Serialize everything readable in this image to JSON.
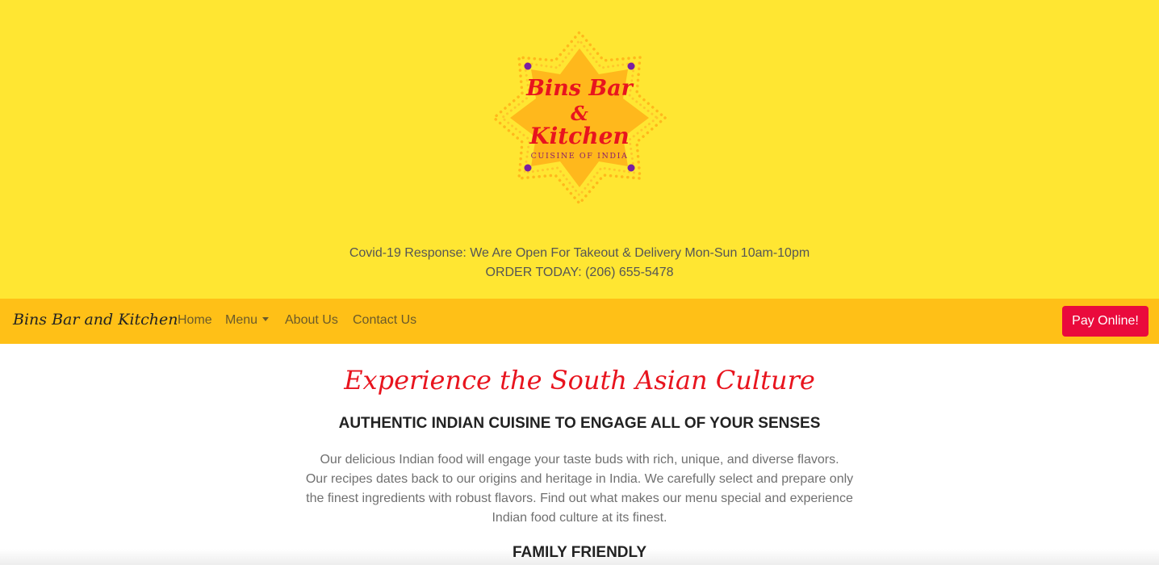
{
  "logo": {
    "line1": "Bins Bar",
    "line2": "&",
    "line3": "Kitchen",
    "subtitle": "CUISINE OF INDIA"
  },
  "banner": {
    "covid_line": "Covid-19 Response: We Are Open For Takeout & Delivery Mon-Sun 10am-10pm",
    "order_line": "ORDER TODAY: (206) 655-5478"
  },
  "navbar": {
    "brand": "Bins Bar and Kitchen",
    "links": [
      "Home",
      "Menu",
      "About Us",
      "Contact Us"
    ],
    "pay_button": "Pay Online!"
  },
  "main": {
    "tagline": "Experience the South Asian Culture",
    "headline": "AUTHENTIC INDIAN CUISINE TO ENGAGE ALL OF YOUR SENSES",
    "paragraph_lines": [
      "Our delicious Indian food will engage your taste buds with rich, unique, and diverse flavors.",
      "Our recipes dates back to our origins and heritage in India. We carefully select and prepare only",
      "the finest ingredients with robust flavors. Find out what makes our menu special and experience",
      "Indian food culture at its finest."
    ],
    "subheading": "FAMILY FRIENDLY"
  },
  "icons": {
    "logo": "mandala-emblem-icon",
    "menu_caret": "chevron-down-icon"
  },
  "colors": {
    "hero_background": "#ffe632",
    "navbar_background": "#ffc017",
    "accent_red": "#e8141e",
    "pay_button": "#ea0a3c",
    "logo_orange": "#ffb81c",
    "logo_dots": "#7a1fa2"
  }
}
